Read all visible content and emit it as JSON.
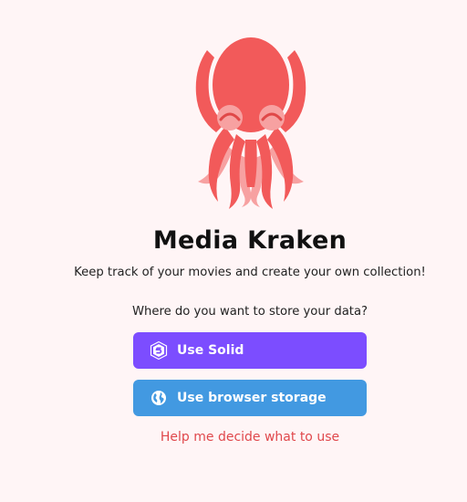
{
  "app": {
    "title": "Media Kraken",
    "tagline": "Keep track of your movies and create your own collection!"
  },
  "storage": {
    "question": "Where do you want to store your data?",
    "solid_button_label": "Use Solid",
    "browser_button_label": "Use browser storage",
    "help_link": "Help me decide what to use"
  },
  "icons": {
    "logo": "octopus-logo",
    "solid": "solid-icon",
    "browser": "globe-icon"
  },
  "colors": {
    "background": "#fff5f6",
    "octopus_body": "#f25a5a",
    "octopus_light": "#f7a1a1",
    "solid_button": "#7c4dff",
    "browser_button": "#4299e1",
    "help_link": "#e0484c"
  }
}
